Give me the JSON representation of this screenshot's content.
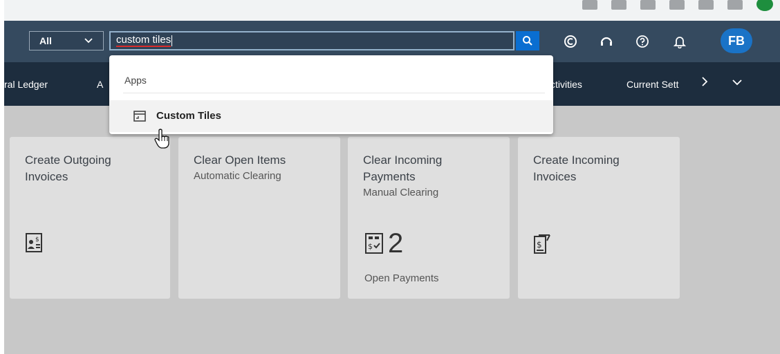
{
  "shell": {
    "scope_value": "All",
    "search_value": "custom tiles",
    "avatar_initials": "FB"
  },
  "nav": {
    "items": [
      "ral Ledger",
      "A",
      "ctivities",
      "Current Sett"
    ]
  },
  "search_dropdown": {
    "section_title": "Apps",
    "items": [
      {
        "label": "Custom Tiles",
        "icon": "tile-app-icon"
      }
    ]
  },
  "tiles": [
    {
      "title": "Create Outgoing Invoices",
      "subtitle": "",
      "icon": "invoice-outgoing-icon"
    },
    {
      "title": "Clear Open Items",
      "subtitle": "Automatic Clearing",
      "icon": ""
    },
    {
      "title": "Clear Incoming Payments",
      "subtitle": "Manual Clearing",
      "icon": "payment-list-icon",
      "kpi_value": "2",
      "footer": "Open Payments"
    },
    {
      "title": "Create Incoming Invoices",
      "subtitle": "",
      "icon": "invoice-incoming-icon"
    }
  ]
}
